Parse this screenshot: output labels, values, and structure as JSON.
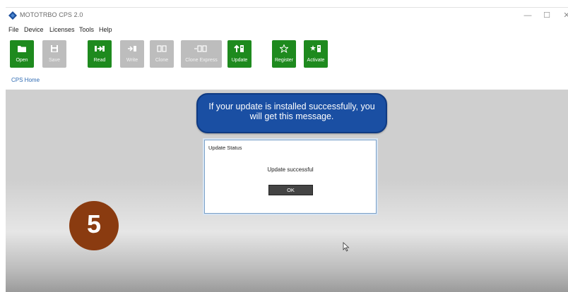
{
  "window": {
    "title": "MOTOTRBO CPS 2.0",
    "min_glyph": "—",
    "max_glyph": "☐",
    "close_glyph": "✕"
  },
  "menu": [
    "File",
    "Device",
    "Licenses",
    "Tools",
    "Help"
  ],
  "toolbar": [
    {
      "label": "Open",
      "icon": "folder-icon",
      "enabled": true
    },
    {
      "label": "Save",
      "icon": "save-icon",
      "enabled": false
    },
    {
      "label": "Read",
      "icon": "read-icon",
      "enabled": true
    },
    {
      "label": "Write",
      "icon": "write-icon",
      "enabled": false
    },
    {
      "label": "Clone",
      "icon": "clone-icon",
      "enabled": false
    },
    {
      "label": "Clone Express",
      "icon": "clone-express-icon",
      "enabled": false
    },
    {
      "label": "Update",
      "icon": "update-icon",
      "enabled": true
    },
    {
      "label": "Register",
      "icon": "star-icon",
      "enabled": true
    },
    {
      "label": "Activate",
      "icon": "activate-icon",
      "enabled": true
    }
  ],
  "breadcrumb": "CPS Home",
  "callout": {
    "text": "If your update is installed successfully, you will get this message."
  },
  "dialog": {
    "title": "Update Status",
    "message": "Update successful",
    "ok_label": "OK"
  },
  "step_badge": "5",
  "colors": {
    "toolbar_green": "#1e8a1e",
    "toolbar_disabled": "#bdbdbd",
    "callout_blue": "#1a4fa3",
    "badge_brown": "#8a3b10",
    "link_blue": "#2f6bb3"
  }
}
